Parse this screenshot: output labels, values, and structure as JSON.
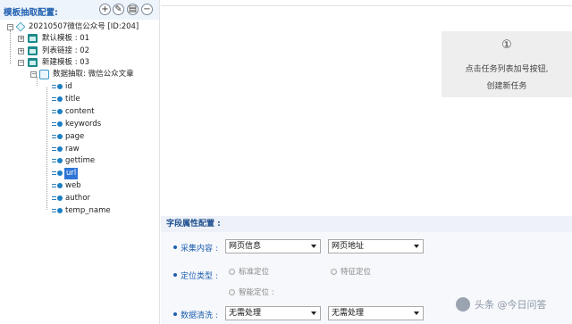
{
  "left_panel": {
    "title": "模板抽取配置:",
    "toolbar": {
      "add": "+",
      "edit": "✎",
      "copy": "▤",
      "remove": "−"
    },
    "tree": {
      "root": {
        "expander": "⊟",
        "label": "20210507微信公众号 [ID:204]"
      },
      "templates": [
        {
          "expander": "⊞",
          "label": "默认模板 : 01"
        },
        {
          "expander": "⊞",
          "label": "列表链接 : 02"
        },
        {
          "expander": "⊟",
          "label": "新建模板 : 03"
        }
      ],
      "extraction": {
        "expander": "⊟",
        "label": "数据抽取: 微信公众文章"
      },
      "fields": [
        "id",
        "title",
        "content",
        "keywords",
        "page",
        "raw",
        "gettime",
        "url",
        "web",
        "author",
        "temp_name"
      ],
      "selected_field": "url"
    }
  },
  "hint": {
    "number": "①",
    "line1": "点击任务列表加号按钮,",
    "line2": "创建新任务"
  },
  "field_config": {
    "title": "字段属性配置 :",
    "collect": {
      "label": "采集内容 :",
      "select1": "网页信息",
      "select2": "网页地址"
    },
    "locate": {
      "label": "定位类型 :",
      "opt1": "标准定位",
      "opt2": "特征定位",
      "opt3": "智能定位 :"
    },
    "clean": {
      "label": "数据清洗 :",
      "select1": "无需处理",
      "select2": "无需处理"
    }
  },
  "watermark": "头条 @今日问答"
}
